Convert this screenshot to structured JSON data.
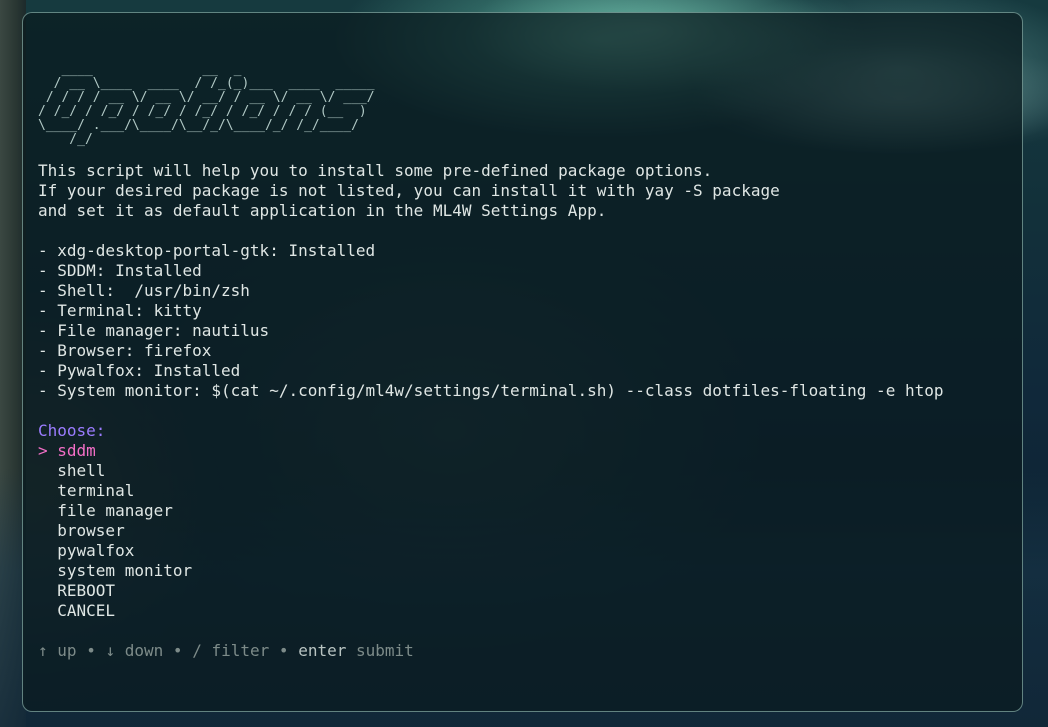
{
  "header": {
    "logo_ascii": "   ____              __  _\n  / __ \\____  ____  / /_(_)___  ____  _____\n / / / / __ \\/ __ \\/ __/ / __ \\/ __ \\/ ___/\n/ /_/ / /_/ / /_/ / /_/ / /_/ / / / (__  )\n\\____/ .___/\\____/\\__/_/\\____/_/ /_/____/\n    /_/"
  },
  "intro": [
    "This script will help you to install some pre-defined package options.",
    "If your desired package is not listed, you can install it with yay -S package",
    "and set it as default application in the ML4W Settings App."
  ],
  "status": [
    "- xdg-desktop-portal-gtk: Installed",
    "- SDDM: Installed",
    "- Shell:  /usr/bin/zsh",
    "- Terminal: kitty",
    "- File manager: nautilus",
    "- Browser: firefox",
    "- Pywalfox: Installed",
    "- System monitor: $(cat ~/.config/ml4w/settings/terminal.sh) --class dotfiles-floating -e htop"
  ],
  "menu": {
    "prompt": "Choose:",
    "cursor": ">",
    "selected_index": 0,
    "options": [
      "sddm",
      "shell",
      "terminal",
      "file manager",
      "browser",
      "pywalfox",
      "system monitor",
      "REBOOT",
      "CANCEL"
    ]
  },
  "help": {
    "up_key": "↑",
    "up_label": "up",
    "down_key": "↓",
    "down_label": "down",
    "filter_key": "/",
    "filter_label": "filter",
    "submit_key": "enter",
    "submit_label": "submit",
    "separator": "•"
  },
  "colors": {
    "prompt": "#9b7cff",
    "selected": "#f36fc7",
    "text": "#dfe6e4",
    "help": "#7d8b89"
  }
}
